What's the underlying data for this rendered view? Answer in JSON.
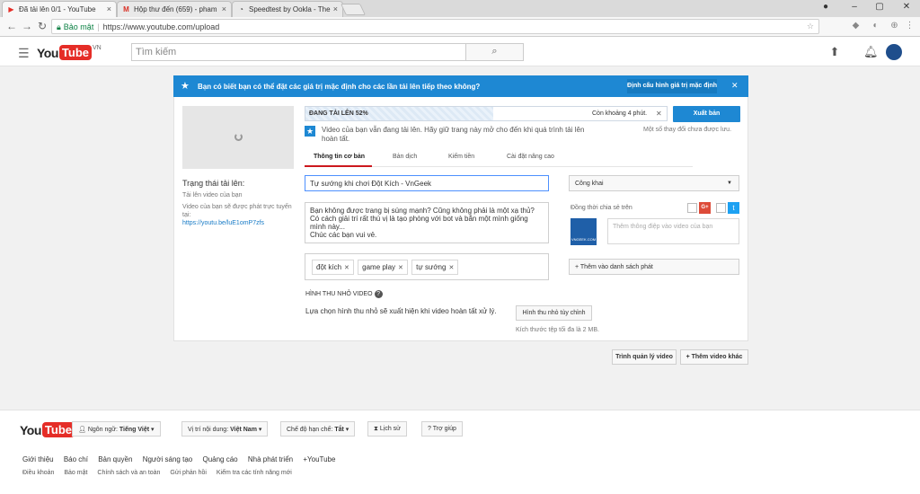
{
  "browser": {
    "tabs": [
      {
        "title": "Đã tải lên 0/1 - YouTube",
        "icon": "youtube-icon",
        "active": true
      },
      {
        "title": "Hộp thư đến (659) - pham",
        "icon": "gmail-icon",
        "active": false
      },
      {
        "title": "Speedtest by Ookla - The",
        "icon": "speedtest-icon",
        "active": false
      }
    ],
    "secure_label": "Bảo mật",
    "url": "https://www.youtube.com/upload"
  },
  "header": {
    "logo_you": "You",
    "logo_tube": "Tube",
    "logo_region": "VN",
    "search_placeholder": "Tìm kiếm"
  },
  "banner": {
    "message": "Bạn có biết bạn có thể đặt các giá trị mặc định cho các lần tải lên tiếp theo không?",
    "button": "Định cấu hình giá trị mặc định"
  },
  "upload": {
    "progress_label": "ĐANG TẢI LÊN 52%",
    "progress": 0.52,
    "remaining": "Còn khoảng 4 phút.",
    "publish_button": "Xuất bản",
    "publish_note": "Một số thay đổi chưa được lưu.",
    "info_note": "Video của bạn vẫn đang tải lên. Hãy giữ trang này mở cho đến khi quá trình tải lên hoàn tất."
  },
  "tabs": [
    "Thông tin cơ bản",
    "Bản dịch",
    "Kiếm tiền",
    "Cài đặt nâng cao"
  ],
  "status": {
    "title": "Trạng thái tải lên:",
    "line1": "Tải lên video của bạn",
    "line2": "Video của bạn sẽ được phát trực tuyến tại:",
    "link": "https://youtu.be/luE1omP7zfs"
  },
  "form": {
    "title_value": "Tự sướng khi chơi Đột Kích - VnGeek",
    "description": "Bạn không được trang bị súng mạnh? Cũng không phải là một xạ thủ?\nCó cách giải trí rất thú vị là tạo phòng với bot và bắn một mình giống mình này...\nChúc các bạn vui vẻ.",
    "tags": [
      "đột kích",
      "game play",
      "tự sướng"
    ],
    "privacy": "Công khai",
    "share_label": "Đồng thời chia sẻ trên",
    "share_placeholder": "Thêm thông điệp vào video của bạn",
    "share_avatar_text": "VNGEEK.COM",
    "playlist_button": "+ Thêm vào danh sách phát",
    "thumb_heading": "HÌNH THU NHỎ VIDEO",
    "thumb_desc": "Lựa chọn hình thu nhỏ sẽ xuất hiện khi video hoàn tất xử lý.",
    "custom_thumb_button": "Hình thu nhỏ tùy chỉnh",
    "thumb_size": "Kích thước tệp tối đa là 2 MB."
  },
  "bottom_buttons": {
    "manager": "Trình quản lý video",
    "add_more": "+ Thêm video khác"
  },
  "footer": {
    "language": "Ngôn ngữ:",
    "language_value": "Tiếng Việt",
    "location": "Vị trí nội dung:",
    "location_value": "Việt Nam",
    "restricted": "Chế độ hạn chế:",
    "restricted_value": "Tắt",
    "history": "Lịch sử",
    "help": "Trợ giúp",
    "links1": [
      "Giới thiệu",
      "Báo chí",
      "Bản quyền",
      "Người sáng tạo",
      "Quảng cáo",
      "Nhà phát triển",
      "+YouTube"
    ],
    "links2": [
      "Điều khoản",
      "Bảo mật",
      "Chính sách và an toàn",
      "Gửi phản hồi",
      "Kiểm tra các tính năng mới"
    ]
  },
  "colors": {
    "brand_red": "#e52d27",
    "accent_blue": "#1e88d3"
  }
}
